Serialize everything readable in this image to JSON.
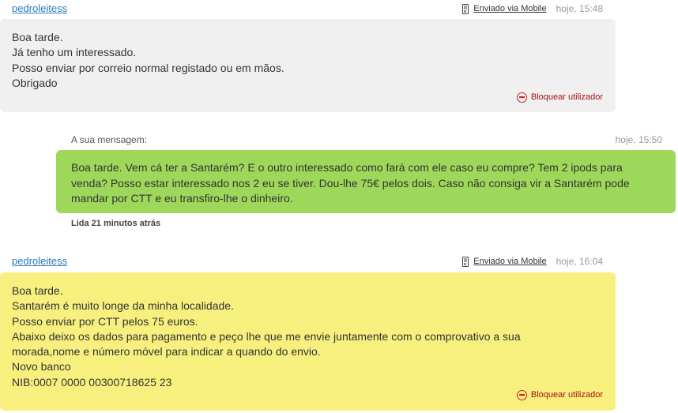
{
  "messages": [
    {
      "username": "pedroleitess",
      "via": "Enviado via Mobile",
      "time": "hoje, 15:48",
      "lines": [
        "Boa tarde.",
        "Já tenho um interessado.",
        "Posso enviar por correio normal registado ou em mãos.",
        "Obrigado"
      ],
      "block_label": "Bloquear utilizador"
    },
    {
      "own_label": "A sua mensagem:",
      "time": "hoje, 15:50",
      "lines": [
        "Boa tarde. Vem cá ter a Santarém? E o outro interessado como fará com ele caso eu compre? Tem 2 ipods para",
        "venda? Posso estar interessado nos 2 eu se tiver. Dou-lhe 75€ pelos dois. Caso não consiga vir a Santarém pode",
        "mandar por CTT e eu transfiro-lhe o dinheiro."
      ],
      "read_status": "Lida 21 minutos atrás"
    },
    {
      "username": "pedroleitess",
      "via": "Enviado via Mobile",
      "time": "hoje, 16:04",
      "lines": [
        "Boa tarde.",
        "Santarém é muito longe da minha localidade.",
        "Posso enviar por CTT pelos 75 euros.",
        "Abaixo deixo os dados para pagamento e peço lhe que me envie juntamente com o comprovativo a sua",
        "morada,nome e número móvel para indicar a quando do envio.",
        "Novo banco",
        "NIB:0007 0000 00300718625 23"
      ],
      "block_label": "Bloquear utilizador"
    }
  ],
  "colors": {
    "gray_bubble": "#f0f0f0",
    "green_bubble": "#9ed85a",
    "yellow_bubble": "#f7f07e",
    "link": "#2a7ab9",
    "block": "#aa1111"
  }
}
